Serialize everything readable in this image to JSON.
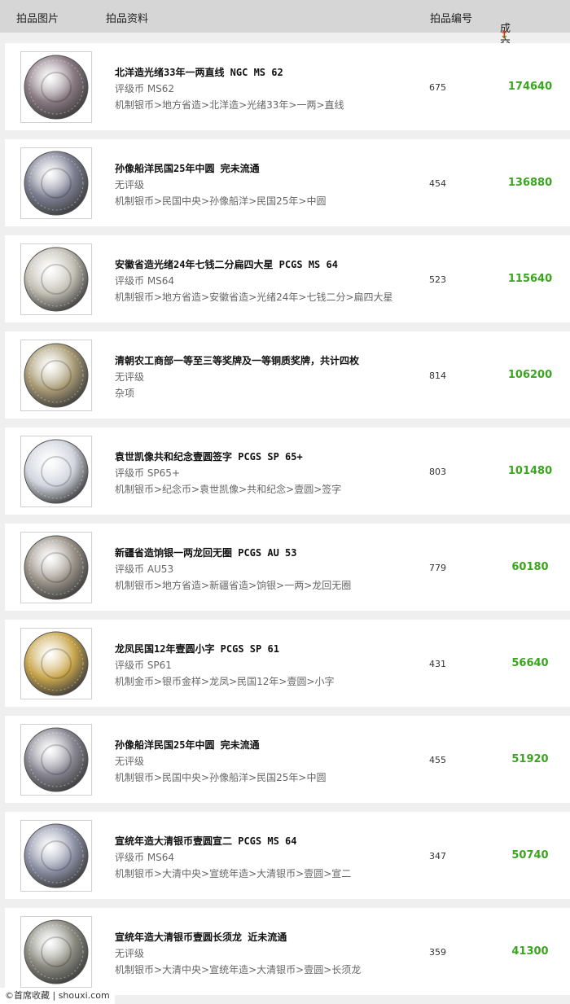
{
  "header": {
    "image_col": "拍品图片",
    "info_col": "拍品资料",
    "number_col": "拍品编号",
    "price_col": "成交价",
    "sort_down": "↓",
    "sort_up": "↑"
  },
  "items": [
    {
      "title": "北洋造光绪33年一两直线 NGC MS 62",
      "grade": "评级币 MS62",
      "category": "机制银币>地方省造>北洋造>光绪33年>一两>直线",
      "lot": "675",
      "price": "174640",
      "coin_tone": "#8a7a82"
    },
    {
      "title": "孙像船洋民国25年中圆 完未流通",
      "grade": "无评级",
      "category": "机制银币>民国中央>孙像船洋>民国25年>中圆",
      "lot": "454",
      "price": "136880",
      "coin_tone": "#7d7f92"
    },
    {
      "title": "安徽省造光绪24年七钱二分扁四大星 PCGS MS 64",
      "grade": "评级币 MS64",
      "category": "机制银币>地方省造>安徽省造>光绪24年>七钱二分>扁四大星",
      "lot": "523",
      "price": "115640",
      "coin_tone": "#c2bfb4"
    },
    {
      "title": "清朝农工商部一等至三等奖牌及一等铜质奖牌，共计四枚",
      "grade": "无评级",
      "category": "杂项",
      "lot": "814",
      "price": "106200",
      "coin_tone": "#a89a74"
    },
    {
      "title": "袁世凯像共和纪念壹圆签字 PCGS SP 65+",
      "grade": "评级币 SP65+",
      "category": "机制银币>纪念币>袁世凯像>共和纪念>壹圆>签字",
      "lot": "803",
      "price": "101480",
      "coin_tone": "#d2d5df"
    },
    {
      "title": "新疆省造饷银一两龙回无圈 PCGS AU 53",
      "grade": "评级币 AU53",
      "category": "机制银币>地方省造>新疆省造>饷银>一两>龙回无圈",
      "lot": "779",
      "price": "60180",
      "coin_tone": "#9c948a"
    },
    {
      "title": "龙凤民国12年壹圆小字 PCGS SP 61",
      "grade": "评级币 SP61",
      "category": "机制金币>银币金样>龙凤>民国12年>壹圆>小字",
      "lot": "431",
      "price": "56640",
      "coin_tone": "#c9a64c"
    },
    {
      "title": "孙像船洋民国25年中圆 完未流通",
      "grade": "无评级",
      "category": "机制银币>民国中央>孙像船洋>民国25年>中圆",
      "lot": "455",
      "price": "51920",
      "coin_tone": "#8a8894"
    },
    {
      "title": "宣统年造大清银币壹圆宣二 PCGS MS 64",
      "grade": "评级币 MS64",
      "category": "机制银币>大清中央>宣统年造>大清银币>壹圆>宣二",
      "lot": "347",
      "price": "50740",
      "coin_tone": "#8f93a8"
    },
    {
      "title": "宣统年造大清银币壹圆长须龙 近未流通",
      "grade": "无评级",
      "category": "机制银币>大清中央>宣统年造>大清银币>壹圆>长须龙",
      "lot": "359",
      "price": "41300",
      "coin_tone": "#8c8c82"
    }
  ],
  "watermark": "©首席收藏 | shouxi.com"
}
